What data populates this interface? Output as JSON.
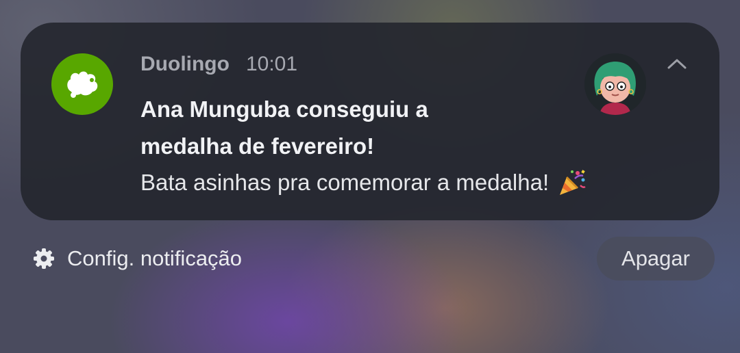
{
  "notification": {
    "app_name": "Duolingo",
    "time": "10:01",
    "title": "Ana Munguba conseguiu a medalha de fevereiro!",
    "body": "Bata asinhas pra comemorar a medalha!",
    "body_emoji": "party-popper-icon",
    "app_icon": "duolingo-owl-icon",
    "app_icon_color": "#58a700",
    "avatar": "user-avatar",
    "collapse_icon": "chevron-up-icon"
  },
  "footer": {
    "settings_icon": "gear-icon",
    "settings_label": "Config. notificação",
    "clear_label": "Apagar"
  }
}
